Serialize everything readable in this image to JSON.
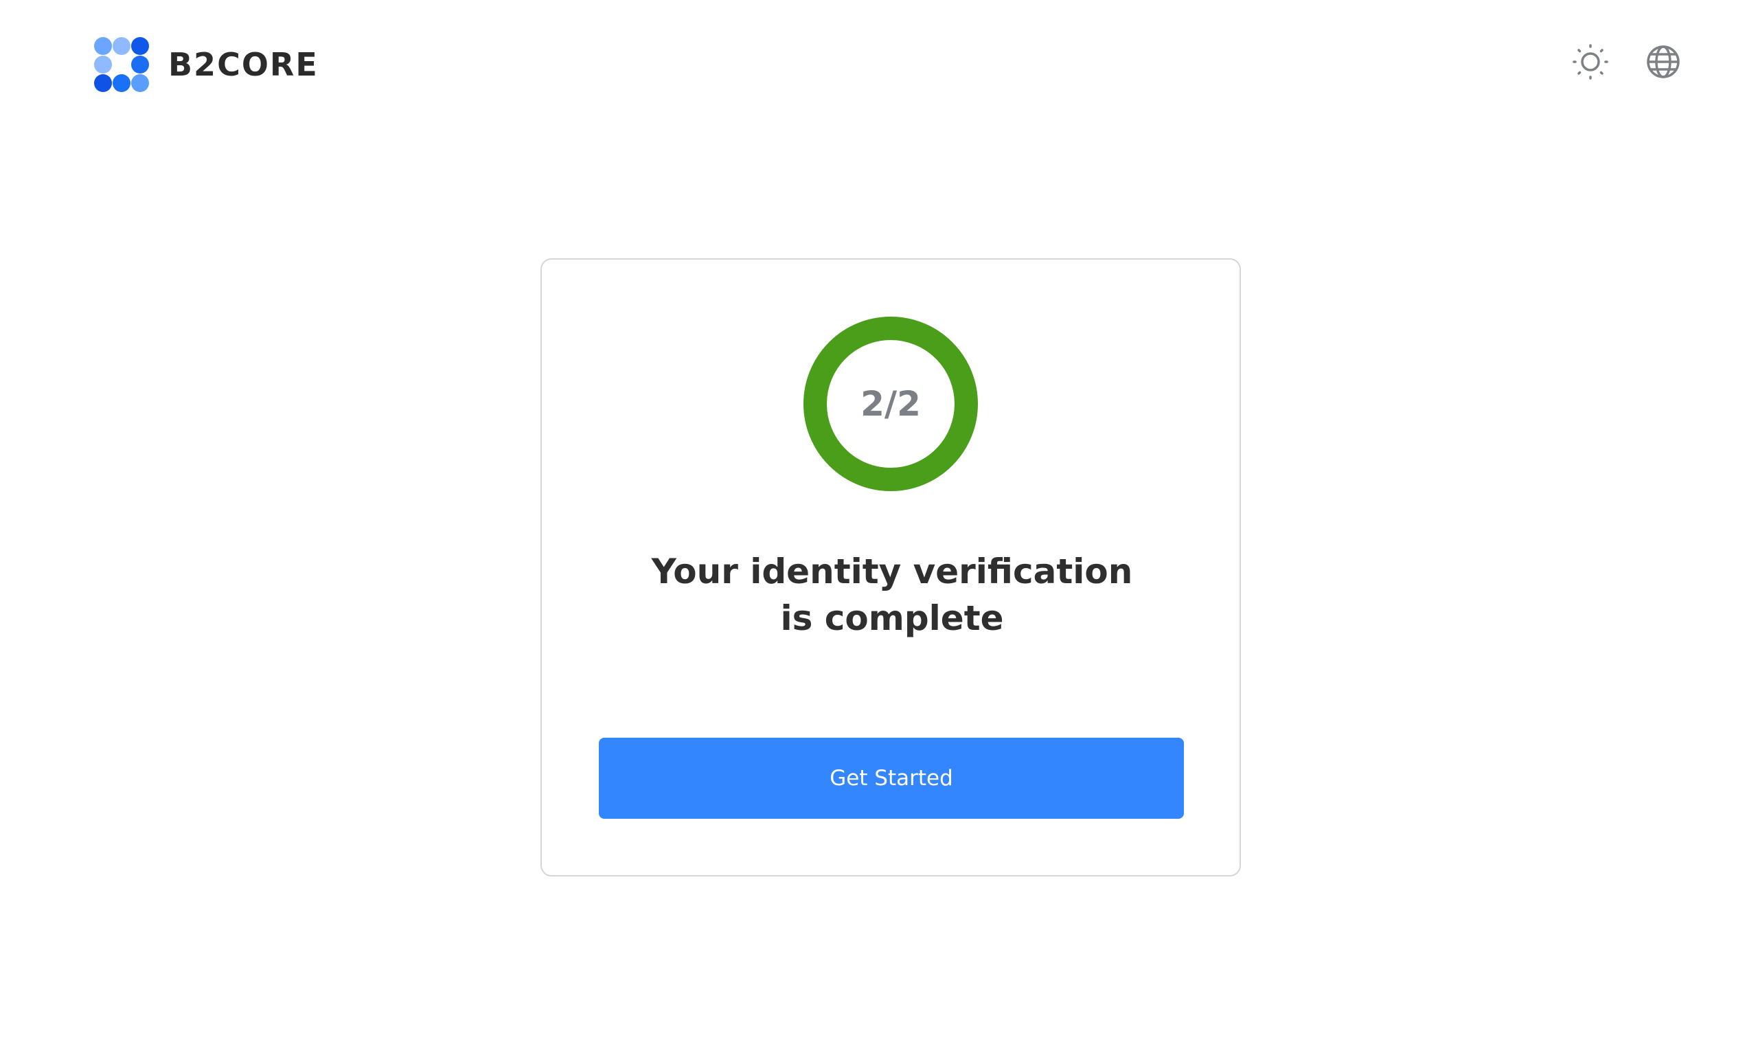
{
  "header": {
    "brand_name": "B2CORE",
    "logo_colors": {
      "light": "#7fb0ff",
      "mid": "#5a9dff",
      "dark": "#1467f5"
    },
    "actions": [
      {
        "icon": "sun-icon",
        "label": ""
      },
      {
        "icon": "globe-icon",
        "label": ""
      }
    ]
  },
  "card": {
    "progress": {
      "label": "2/2",
      "completed": 2,
      "total": 2,
      "color": "#4a9e1a"
    },
    "title_line1": "Your identity verification",
    "title_line2": "is complete",
    "button_label": "Get Started",
    "button_color": "#3486ff"
  }
}
